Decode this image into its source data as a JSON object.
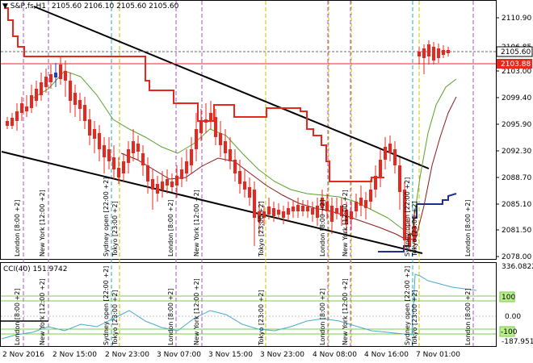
{
  "header": {
    "symbol_text": "S&P,fs,H1",
    "ohlc_text": "2105.60 2106.10 2105.60 2105.60"
  },
  "indicator": {
    "label": "CCI(40) 151.9742"
  },
  "price_axis": {
    "ticks": [
      "2110.90",
      "2106.85",
      "2103.00",
      "2099.40",
      "2095.90",
      "2092.30",
      "2088.70",
      "2085.10",
      "2081.50",
      "2078.00"
    ],
    "current_bid": "2105.60",
    "current_ask": "2103.88"
  },
  "cci_axis": {
    "ticks": [
      "336.0822",
      "0.00",
      "-187.9514"
    ],
    "level_top": "100",
    "level_bottom": "-100"
  },
  "time_axis": {
    "labels": [
      "2 Nov 2016",
      "2 Nov 15:00",
      "2 Nov 23:00",
      "3 Nov 07:00",
      "3 Nov 15:00",
      "3 Nov 23:00",
      "4 Nov 08:00",
      "4 Nov 16:00",
      "7 Nov 01:00"
    ]
  },
  "session_labels": [
    "London [8:00 +2]",
    "New York [12:00 +2]",
    "Sydney open [22:00 +2]",
    "Tokyo [23:00 +2]",
    "London [8:00 +2]",
    "New York [12:00 +2]",
    "Tokyo [23:00 +2]",
    "London [8:00 +2]",
    "New York [12:00 +2]",
    "Sydney open [22:00 +2]",
    "Tokyo [23:00 +2]",
    "London [8:00 +2]"
  ],
  "colors": {
    "up_candle": "#1f3fbf",
    "down_candle": "#e8281e",
    "support_line": "#e8281e",
    "ma_fast": "#5aa02c",
    "ma_slow": "#8b1a1a",
    "cci_line": "#4aa9cf",
    "cci_levels": "#7ec850"
  }
}
